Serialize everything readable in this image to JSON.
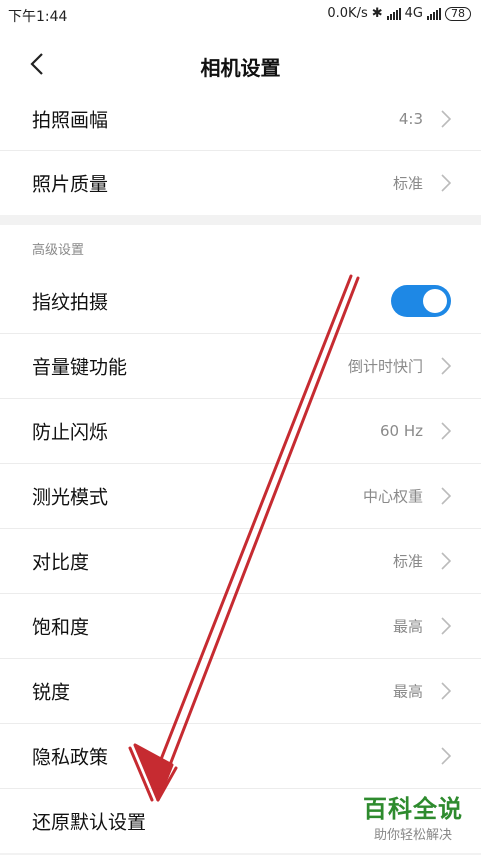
{
  "status_bar": {
    "time": "下午1:44",
    "network": "0.0K/s",
    "signal_label": "4G",
    "battery": "78"
  },
  "header": {
    "title": "相机设置"
  },
  "group1": [
    {
      "label": "拍照画幅",
      "value": "4:3"
    },
    {
      "label": "照片质量",
      "value": "标准"
    }
  ],
  "advanced": {
    "section_title": "高级设置",
    "fingerprint": {
      "label": "指纹拍摄",
      "enabled": true
    },
    "items": [
      {
        "label": "音量键功能",
        "value": "倒计时快门"
      },
      {
        "label": "防止闪烁",
        "value": "60 Hz"
      },
      {
        "label": "测光模式",
        "value": "中心权重"
      },
      {
        "label": "对比度",
        "value": "标准"
      },
      {
        "label": "饱和度",
        "value": "最高"
      },
      {
        "label": "锐度",
        "value": "最高"
      },
      {
        "label": "隐私政策",
        "value": ""
      },
      {
        "label": "还原默认设置",
        "value": ""
      }
    ]
  },
  "watermark": {
    "brand": "百科全说",
    "slogan": "助你轻松解决"
  },
  "colors": {
    "accent": "#1e88e5",
    "annotation_arrow": "#c0151b",
    "watermark": "#2e8b2e"
  }
}
